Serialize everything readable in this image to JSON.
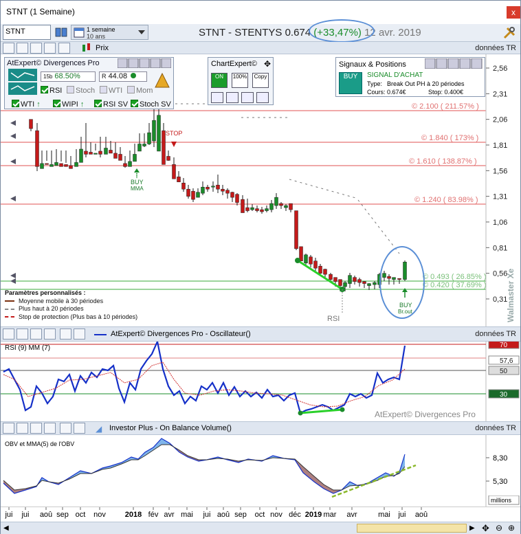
{
  "window": {
    "title": "STNT (1 Semaine)",
    "close": "x"
  },
  "toolbar": {
    "symbol": "STNT",
    "period_main": "1 semaine",
    "period_sub": "10 ans",
    "stock_name": "STNT - STENTYS",
    "price": "0.674",
    "change": "(+33,47%)",
    "date": "12 avr. 2019"
  },
  "price_panel": {
    "label": "Prix",
    "right_label": "données TR",
    "y_ticks": [
      "2,56",
      "2,31",
      "2,06",
      "1,81",
      "1,56",
      "1,31",
      "1,06",
      "0,81",
      "0,56",
      "0,31"
    ],
    "levels": [
      "© 2.100 ( 211.57% )",
      "© 1.840 ( 173% )",
      "© 1.610 ( 138.87% )",
      "© 1.240 ( 83.98% )",
      "© 0.493 ( 26.85% )",
      "© 0.420 ( 37.69% )"
    ],
    "annotations": {
      "buy1": "BUY",
      "buy1_sub": "MMA",
      "stop": "STOP",
      "buy2": "BUY",
      "buy2_sub": "Br.out",
      "rsi": "RSI"
    },
    "watermark": "Walmaster Xe"
  },
  "atexpert": {
    "title": "AtExpert© Divergences Pro",
    "pct": "68.50%",
    "val": "44.08",
    "sub15": "15b",
    "checks": [
      "RSI",
      "Stoch",
      "WTI",
      "Mom"
    ],
    "checks2": [
      "WTI",
      "WIPI",
      "RSI SV",
      "Stoch SV"
    ]
  },
  "chartexpert": {
    "title": "ChartExpert©",
    "btn1": "ON",
    "btn2": "100%",
    "btn3": "Copy"
  },
  "signals": {
    "title": "Signaux & Positions",
    "signal": "SIGNAL D'ACHAT",
    "type_label": "Type:",
    "type_value": "Break Out PH à 20 périodes",
    "price_label": "Cours: 0.674€",
    "stop_label": "Stop: 0.400€",
    "buy_icon": "BUY"
  },
  "params": {
    "title": "Paramètres personnalisés :",
    "items": [
      "Moyenne mobile à 30 périodes",
      "Plus haut à 20 périodes",
      "Stop de protection (Plus bas à 10 périodes)"
    ]
  },
  "oscillator": {
    "title": "AtExpert© Divergences Pro - Oscillateur()",
    "right_label": "données TR",
    "label": "RSI (9) MM (7)",
    "ticks": [
      "70",
      "57,6",
      "50",
      "30"
    ],
    "watermark": "AtExpert© Divergences Pro"
  },
  "obv": {
    "title": "Investor Plus - On Balance Volume()",
    "right_label": "données TR",
    "label": "OBV et MMA(5) de l'OBV",
    "ticks": [
      "8,30",
      "5,30"
    ],
    "units": "millions"
  },
  "xaxis": {
    "labels": [
      "jui",
      "jui",
      "aoû",
      "sep",
      "oct",
      "nov",
      "2018",
      "fév",
      "avr",
      "mai",
      "jui",
      "aoû",
      "sep",
      "oct",
      "nov",
      "déc",
      "2019",
      "mar",
      "avr",
      "mai",
      "jui",
      "aoû"
    ]
  },
  "colors": {
    "accent": "#5b8fd6",
    "up": "#1a8c2a",
    "down": "#c41a1a",
    "rsi": "#1530c8",
    "level": "#e05050"
  }
}
